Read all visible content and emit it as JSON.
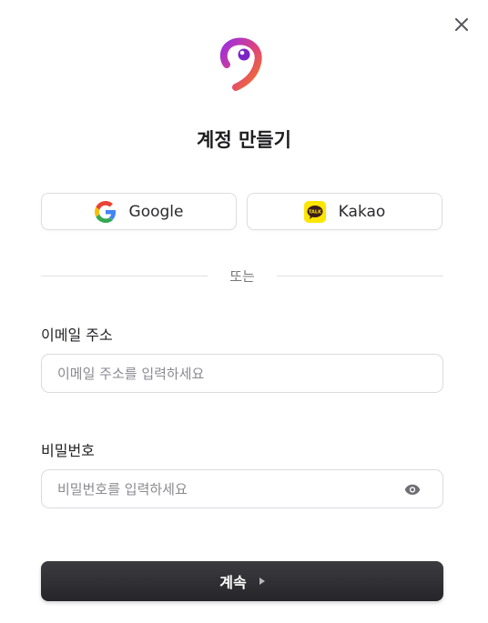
{
  "dialog": {
    "title": "계정 만들기",
    "close_label": "×"
  },
  "social": {
    "google_label": "Google",
    "kakao_label": "Kakao",
    "kakao_badge": "TALK"
  },
  "divider": {
    "text": "또는"
  },
  "form": {
    "email": {
      "label": "이메일 주소",
      "placeholder": "이메일 주소를 입력하세요",
      "value": ""
    },
    "password": {
      "label": "비밀번호",
      "placeholder": "비밀번호를 입력하세요",
      "value": ""
    }
  },
  "submit": {
    "label": "계속"
  },
  "icons": {
    "close": "close-icon",
    "logo": "app-logo",
    "google": "google-icon",
    "kakao": "kakao-icon",
    "eye": "eye-icon",
    "arrow": "play-arrow-icon"
  },
  "colors": {
    "primary_button": "#2f2f33",
    "logo_gradient_start": "#9b2ee0",
    "logo_gradient_end": "#f27a1a",
    "kakao_yellow": "#fee500"
  }
}
